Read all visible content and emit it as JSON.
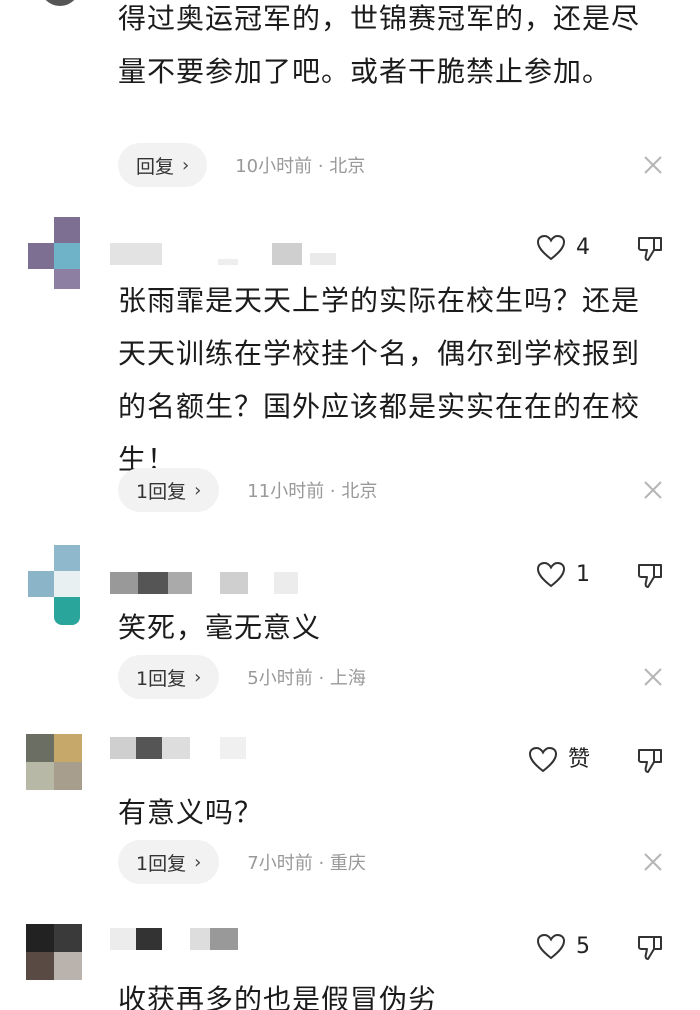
{
  "comments": [
    {
      "text": "得过奥运冠军的，世锦赛冠军的，还是尽量不要参加了吧。或者干脆禁止参加。",
      "reply_label": "回复",
      "time": "10小时前",
      "location": "北京",
      "time_location": "10小时前 · 北京"
    },
    {
      "likes": "4",
      "text": "张雨霏是天天上学的实际在校生吗？还是天天训练在学校挂个名，偶尔到学校报到的名额生？国外应该都是实实在在的在校生！",
      "reply_label": "1回复",
      "time_location": "11小时前 · 北京"
    },
    {
      "likes": "1",
      "text": "笑死，毫无意义",
      "reply_label": "1回复",
      "time_location": "5小时前 · 上海"
    },
    {
      "likes": "赞",
      "text": "有意义吗？",
      "reply_label": "1回复",
      "time_location": "7小时前 · 重庆"
    },
    {
      "likes": "5",
      "text": "收获再多的也是假冒伪劣"
    }
  ],
  "icons": {
    "like": "heart-outline-icon",
    "dislike": "thumbs-down-icon",
    "close": "close-x-icon",
    "chevron": "chevron-right-icon"
  },
  "colors": {
    "reply_bg": "#f2f2f2",
    "meta_text": "#999999",
    "body_text": "#1b1b1b"
  }
}
